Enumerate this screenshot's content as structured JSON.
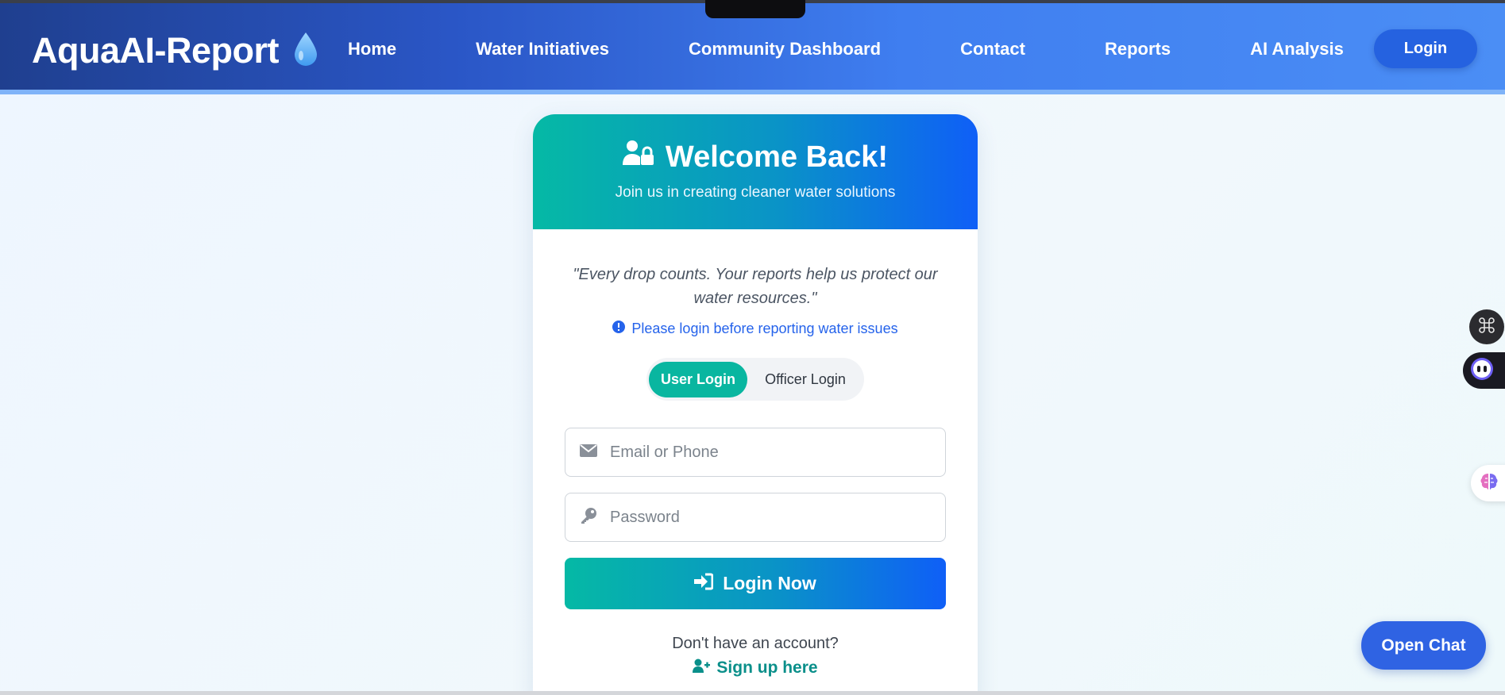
{
  "navbar": {
    "brand": "AquaAI-Report",
    "links": [
      "Home",
      "Water Initiatives",
      "Community Dashboard",
      "Contact",
      "Reports",
      "AI Analysis"
    ],
    "login_label": "Login"
  },
  "card": {
    "title": "Welcome Back!",
    "subtitle": "Join us in creating cleaner water solutions",
    "quote": "\"Every drop counts. Your reports help us protect our water resources.\"",
    "notice": "Please login before reporting water issues",
    "toggle": {
      "user_label": "User Login",
      "officer_label": "Officer Login",
      "active": "User Login"
    },
    "email_placeholder": "Email or Phone",
    "password_placeholder": "Password",
    "submit_label": "Login Now",
    "no_account_text": "Don't have an account?",
    "signup_label": "Sign up here"
  },
  "open_chat_label": "Open Chat",
  "colors": {
    "accent_teal": "#09b6a0",
    "accent_blue": "#0f5ff7",
    "nav_dark": "#1f3f8f",
    "link_blue": "#2563eb"
  },
  "icons": [
    "water-drop-icon",
    "user-lock-icon",
    "info-circle-icon",
    "envelope-icon",
    "key-icon",
    "sign-in-icon",
    "user-plus-icon",
    "command-icon",
    "bot-face-icon",
    "brain-icon"
  ]
}
